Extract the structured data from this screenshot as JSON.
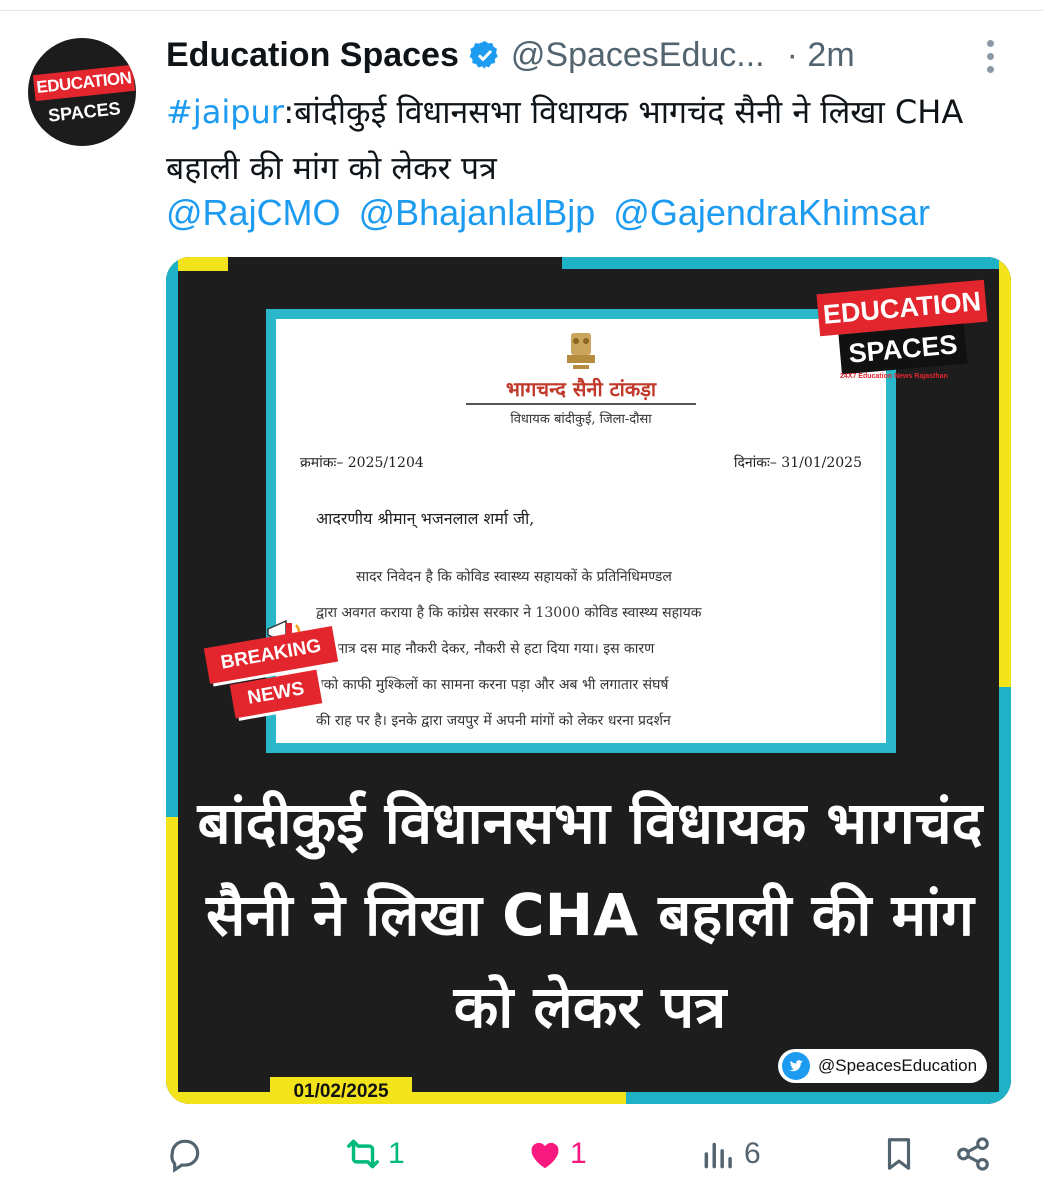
{
  "tweet": {
    "author_name": "Education Spaces",
    "handle": "@SpacesEduc...",
    "time": "· 2m",
    "avatar_text_top": "EDUCATION",
    "avatar_text_bottom": "SPACES",
    "hashtag": "#jaipur",
    "text": ":बांदीकुई विधानसभा विधायक भागचंद सैनी ने लिखा CHA बहाली की मांग को लेकर पत्र",
    "mentions": [
      "@RajCMO",
      "@BhajanlalBjp",
      "@GajendraKhimsar"
    ]
  },
  "media": {
    "letter": {
      "name": "भागचन्द सैनी टांकड़ा",
      "designation": "विधायक बांदीकुई, जिला-दौसा",
      "ref": "क्रमांकः– 2025/1204",
      "date": "दिनांकः– 31/01/2025",
      "salutation": "आदरणीय श्रीमान् भजनलाल शर्मा जी,",
      "lines": [
        "सादर निवेदन है कि कोविड स्वास्थ्य सहायकों के प्रतिनिधिमण्डल",
        "द्वारा अवगत कराया है कि कांग्रेस सरकार ने 13000 कोविड स्वास्थ्य सहायक",
        "मात्र दस माह नौकरी देकर, नौकरी से हटा दिया गया। इस कारण",
        "नको काफी मुश्किलों का सामना करना पड़ा और अब भी लगातार संघर्ष",
        "की राह पर है। इनके द्वारा जयपुर में अपनी मांगों को लेकर धरना प्रदर्शन"
      ]
    },
    "brand_top": "EDUCATION",
    "brand_bottom": "SPACES",
    "brand_tagline": "24X7 Education News Rajasthan",
    "breaking_1": "BREAKING",
    "breaking_2": "NEWS",
    "headline": "बांदीकुई विधानसभा विधायक भागचंद सैनी ने लिखा CHA बहाली की मांग को लेकर पत्र",
    "twitter_tag": "@SpeacesEducation",
    "date_tag": "01/02/2025"
  },
  "actions": {
    "reply_count": "",
    "retweet_count": "1",
    "like_count": "1",
    "views_count": "6"
  },
  "colors": {
    "link": "#1d9bf0",
    "retweet": "#00ba7c",
    "like": "#f91880",
    "muted": "#536471"
  }
}
